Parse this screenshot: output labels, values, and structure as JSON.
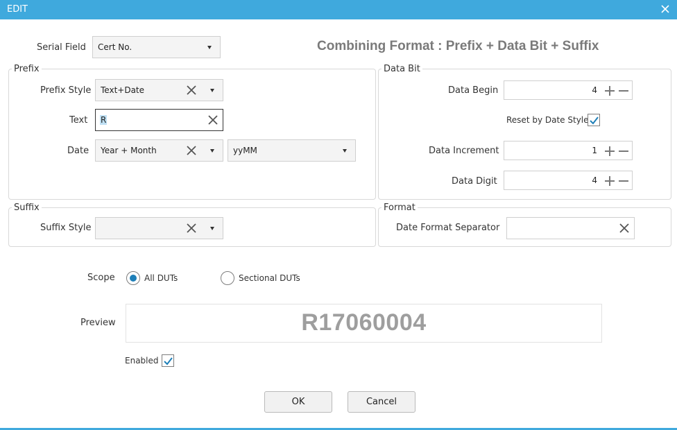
{
  "window": {
    "title": "EDIT"
  },
  "header": {
    "combining_format": "Combining Format : Prefix + Data Bit + Suffix"
  },
  "serial_field": {
    "label": "Serial Field",
    "value": "Cert No."
  },
  "prefix": {
    "title": "Prefix",
    "style_label": "Prefix Style",
    "style_value": "Text+Date",
    "text_label": "Text",
    "text_value": "R",
    "date_label": "Date",
    "date_value": "Year + Month",
    "date_format": "yyMM"
  },
  "data_bit": {
    "title": "Data Bit",
    "begin_label": "Data Begin",
    "begin_value": "4",
    "reset_label": "Reset by Date Style",
    "reset_checked": true,
    "increment_label": "Data Increment",
    "increment_value": "1",
    "digit_label": "Data Digit",
    "digit_value": "4"
  },
  "suffix": {
    "title": "Suffix",
    "style_label": "Suffix Style",
    "style_value": ""
  },
  "format": {
    "title": "Format",
    "separator_label": "Date Format Separator",
    "separator_value": ""
  },
  "scope": {
    "label": "Scope",
    "options": [
      "All DUTs",
      "Sectional DUTs"
    ],
    "selected": "All DUTs"
  },
  "preview": {
    "label": "Preview",
    "value": "R17060004"
  },
  "enabled": {
    "label": "Enabled",
    "checked": true
  },
  "buttons": {
    "ok": "OK",
    "cancel": "Cancel"
  },
  "colors": {
    "titlebar": "#3fa9dd",
    "accent": "#1e7fb8",
    "preview_text": "#9e9e9e"
  }
}
